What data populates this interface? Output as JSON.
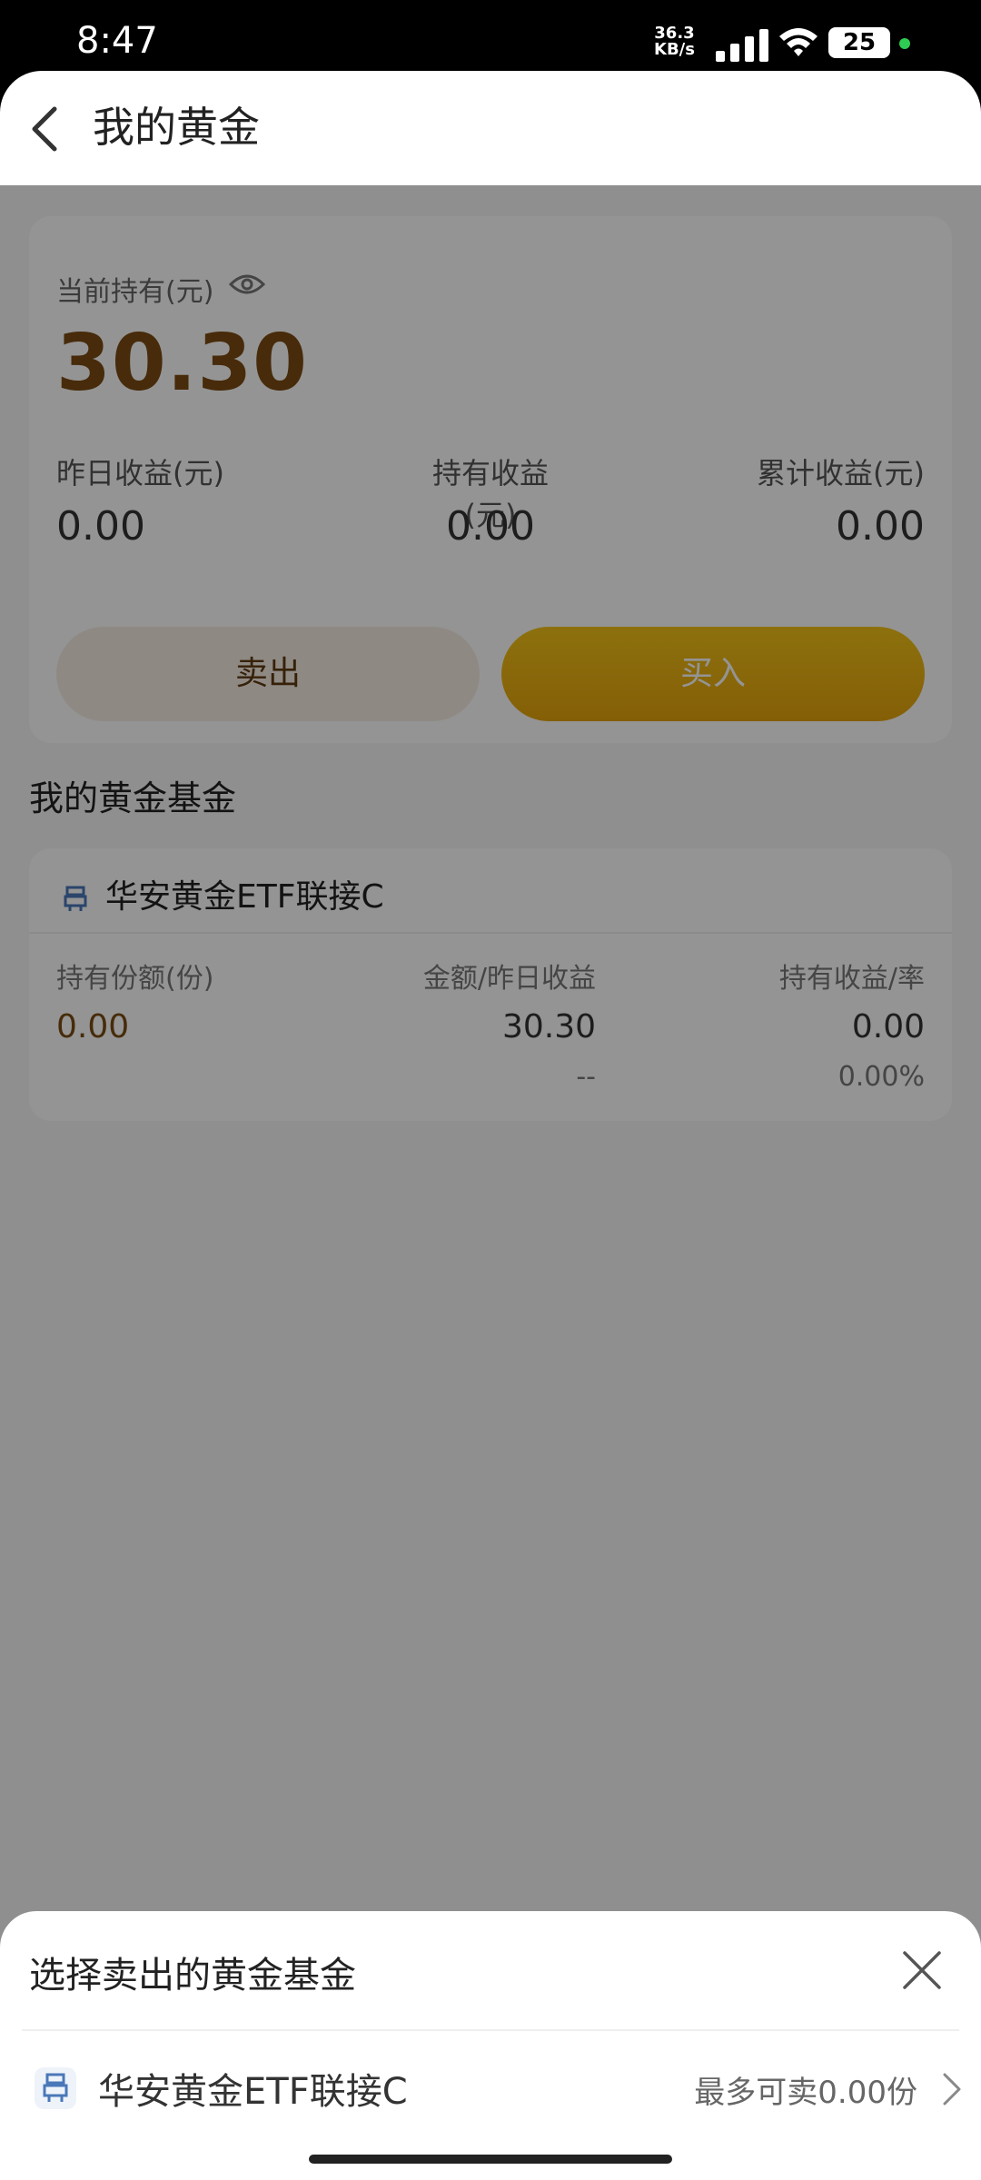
{
  "status_bar": {
    "time": "8:47",
    "net_speed_value": "36.3",
    "net_speed_unit": "KB/s",
    "battery": "25"
  },
  "header": {
    "title": "我的黄金"
  },
  "holding": {
    "label": "当前持有(元)",
    "amount": "30.30",
    "stats": [
      {
        "label": "昨日收益(元)",
        "value": "0.00"
      },
      {
        "label": "持有收益(元)",
        "value": "0.00"
      },
      {
        "label": "累计收益(元)",
        "value": "0.00"
      }
    ],
    "sell_label": "卖出",
    "buy_label": "买入"
  },
  "section_title": "我的黄金基金",
  "fund": {
    "name": "华安黄金ETF联接C",
    "columns": [
      {
        "label": "持有份额(份)",
        "value": "0.00",
        "sub": ""
      },
      {
        "label": "金额/昨日收益",
        "value": "30.30",
        "sub": "--"
      },
      {
        "label": "持有收益/率",
        "value": "0.00",
        "sub": "0.00%"
      }
    ]
  },
  "sheet": {
    "title": "选择卖出的黄金基金",
    "item_name": "华安黄金ETF联接C",
    "item_max": "最多可卖0.00份"
  },
  "colors": {
    "amount": "#7a4a12",
    "buy_button": "#e4a30c",
    "sell_button": "#f7ede4"
  }
}
